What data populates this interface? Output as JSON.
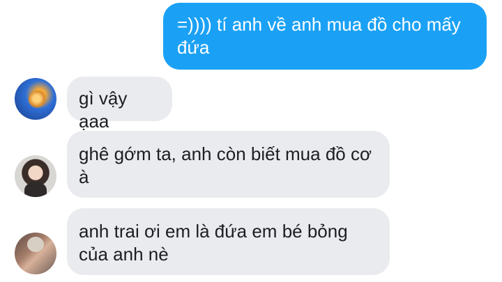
{
  "conversation": {
    "messages": [
      {
        "sender": "me",
        "text": "=)))) tí anh về anh mua đồ cho mấy đứa"
      },
      {
        "sender": "other",
        "avatar_icon": "profile-avatar-icon",
        "text": "gì vậy ạaa"
      },
      {
        "sender": "other",
        "avatar_icon": "profile-avatar-icon",
        "text": "ghê gớm ta, anh còn biết mua đồ cơ à"
      },
      {
        "sender": "other",
        "avatar_icon": "profile-avatar-icon",
        "text": "anh trai ơi em là đứa em bé bỏng của anh nè"
      }
    ]
  },
  "colors": {
    "outgoing_bubble": "#1aa1f5",
    "incoming_bubble": "#e9ebee",
    "outgoing_text": "#ffffff",
    "incoming_text": "#1c1e21"
  }
}
